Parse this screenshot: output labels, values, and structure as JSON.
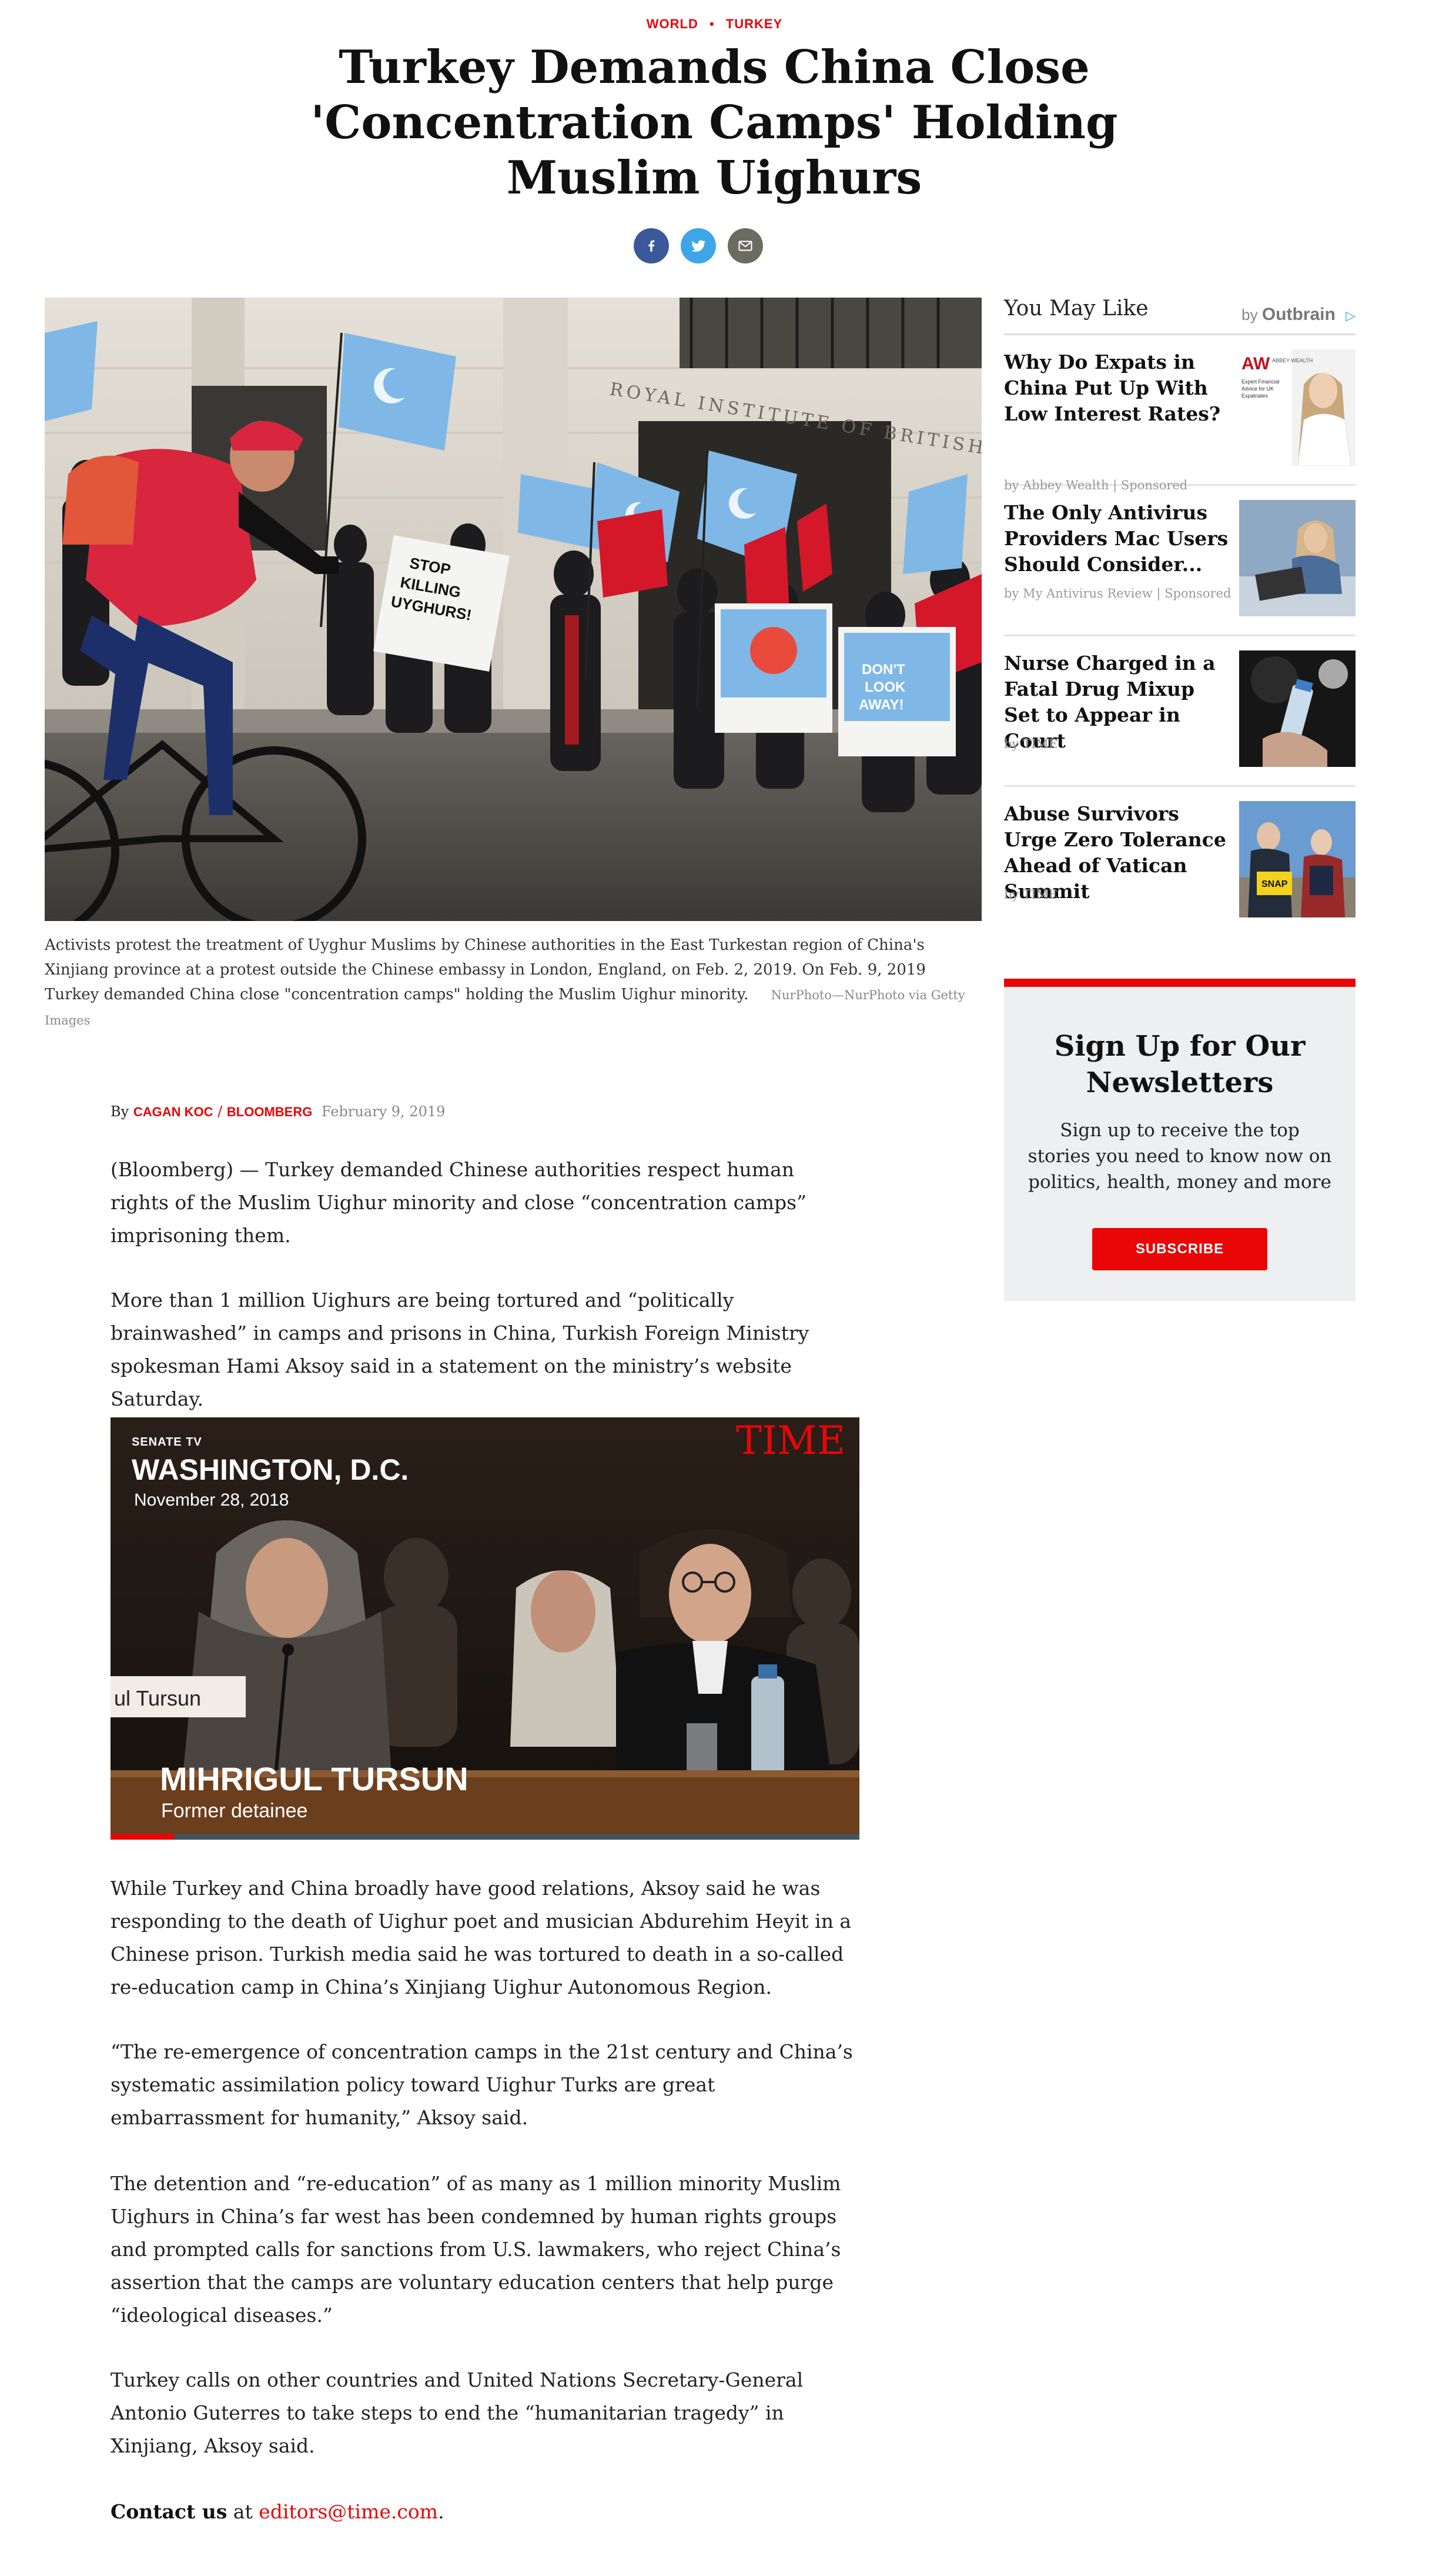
{
  "kicker": {
    "section": "WORLD",
    "separator": "•",
    "subsection": "TURKEY"
  },
  "headline": "Turkey Demands China Close 'Concentration Camps' Holding Muslim Uighurs",
  "share": {
    "facebook_icon": "facebook-icon",
    "twitter_icon": "twitter-icon",
    "email_icon": "email-icon",
    "colors": {
      "facebook": "#3b5998",
      "twitter": "#3ea6e8",
      "email": "#6b6b62"
    }
  },
  "hero": {
    "sign1": "STOP KILLING UYGHURS!",
    "sign2": "DON'T LOOK AWAY!",
    "building": "ROYAL INSTITUTE OF BRITISH ARC",
    "caption": "Activists protest the treatment of Uyghur Muslims by Chinese authorities in the East Turkestan region of China's Xinjiang province at a protest outside the Chinese embassy in London, England, on Feb. 2, 2019. On Feb. 9, 2019 Turkey demanded China close \"concentration camps\" holding the Muslim Uighur minority.",
    "credit": "NurPhoto—NurPhoto via Getty Images"
  },
  "byline": {
    "prefix": "By",
    "author": "CAGAN KOC",
    "sep": "/",
    "outlet": "BLOOMBERG",
    "date": "February 9, 2019"
  },
  "paragraphs": [
    "(Bloomberg) — Turkey demanded Chinese authorities respect human rights of the Muslim Uighur minority and close “concentration camps” imprisoning them.",
    "More than 1 million Uighurs are being tortured and “politically brainwashed” in camps and prisons in China, Turkish Foreign Ministry spokesman Hami Aksoy said in a statement on the ministry’s website Saturday.",
    "While Turkey and China broadly have good relations, Aksoy said he was responding to the death of Uighur poet and musician Abdurehim Heyit in a Chinese prison. Turkish media said he was tortured to death in a so-called re-education camp in China’s Xinjiang Uighur Autonomous Region.",
    "“The re-emergence of concentration camps in the 21st century and China’s systematic assimilation policy toward Uighur Turks are great embarrassment for humanity,” Aksoy said.",
    "The detention and “re-education” of as many as 1 million minority Muslim Uighurs in China’s far west has been condemned by human rights groups and prompted calls for sanctions from U.S. lawmakers, who reject China’s assertion that the camps are voluntary education centers that help purge “ideological diseases.”",
    "Turkey calls on other countries and United Nations Secretary-General Antonio Guterres to take steps to end the “humanitarian tragedy” in Xinjiang, Aksoy said."
  ],
  "contact": {
    "label": "Contact us",
    "at": "at",
    "email": "editors@time.com",
    "end": "."
  },
  "video": {
    "channel": "SENATE TV",
    "location": "WASHINGTON, D.C.",
    "date": "November 28, 2018",
    "brand": "TIME",
    "nameplate": "ul Tursun",
    "lower_third_name": "MIHRIGUL TURSUN",
    "lower_third_title": "Former detainee",
    "progress": 0.085
  },
  "sidebar": {
    "title": "You May Like",
    "by": "by",
    "provider": "Outbrain",
    "items": [
      {
        "title": "Why Do Expats in China Put Up With Low Interest Rates?",
        "source": "by Abbey Wealth | Sponsored",
        "thumb_logo": "AW",
        "thumb_brand": "ABBEY WEALTH",
        "thumb_text": "Expert Financial Advice for UK Expatriates"
      },
      {
        "title": "The Only Antivirus Providers Mac Users Should Consider...",
        "source": "by My Antivirus Review | Sponsored"
      },
      {
        "title": "Nurse Charged in a Fatal Drug Mixup Set to Appear in Court",
        "source": "by TIME"
      },
      {
        "title": "Abuse Survivors Urge Zero Tolerance Ahead of Vatican Summit",
        "source": "by TIME",
        "thumb_sign": "SNAP"
      }
    ]
  },
  "newsletter": {
    "title": "Sign Up for Our Newsletters",
    "text": "Sign up to receive the top stories you need to know now on politics, health, money and more",
    "button": "Subscribe"
  },
  "colors": {
    "accent": "#e90606",
    "text": "#111111",
    "muted": "#888888",
    "panel": "#eeeff1"
  }
}
